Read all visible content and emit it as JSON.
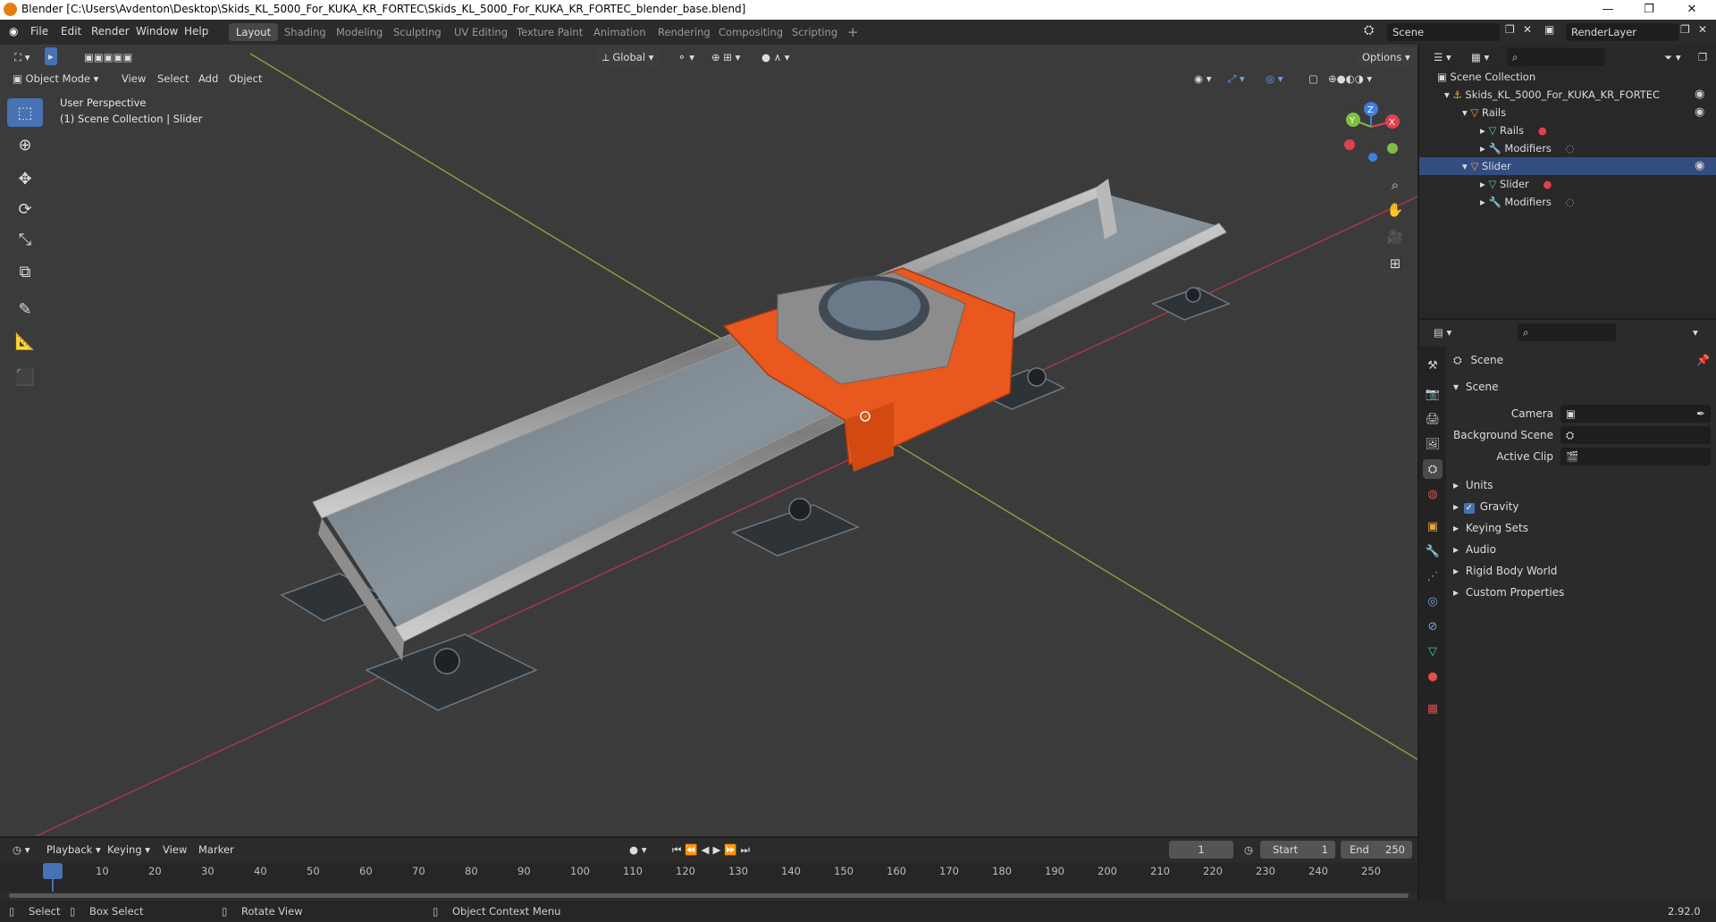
{
  "window": {
    "title": "Blender [C:\\Users\\Avdenton\\Desktop\\Skids_KL_5000_For_KUKA_KR_FORTEC\\Skids_KL_5000_For_KUKA_KR_FORTEC_blender_base.blend]",
    "minimize": "—",
    "maximize": "❐",
    "close": "✕"
  },
  "menu": [
    "File",
    "Edit",
    "Render",
    "Window",
    "Help"
  ],
  "workspaces": [
    "Layout",
    "Shading",
    "Modeling",
    "Sculpting",
    "UV Editing",
    "Texture Paint",
    "Animation",
    "Rendering",
    "Compositing",
    "Scripting"
  ],
  "add_workspace": "+",
  "scene_field": "Scene",
  "renderlayer_field": "RenderLayer",
  "viewport": {
    "mode": "Object Mode",
    "menus": [
      "View",
      "Select",
      "Add",
      "Object"
    ],
    "orientation": "Global",
    "options": "Options",
    "info_line1": "User Perspective",
    "info_line2": "(1) Scene Collection | Slider",
    "gizmo": {
      "x": "X",
      "y": "Y",
      "z": "Z"
    }
  },
  "colors": {
    "accent": "#4772b3",
    "orange": "#e8581f",
    "x_axis": "#e0404f",
    "y_axis": "#7fbf3f",
    "z_axis": "#3f7fe0"
  },
  "outliner": {
    "root": "Scene Collection",
    "items": [
      {
        "label": "Skids_KL_5000_For_KUKA_KR_FORTEC",
        "depth": 1,
        "icon": "armature-icon"
      },
      {
        "label": "Rails",
        "depth": 2,
        "icon": "object-icon"
      },
      {
        "label": "Rails",
        "depth": 3,
        "icon": "mesh-icon"
      },
      {
        "label": "Modifiers",
        "depth": 3,
        "icon": "wrench-icon"
      },
      {
        "label": "Slider",
        "depth": 2,
        "icon": "object-icon"
      },
      {
        "label": "Slider",
        "depth": 3,
        "icon": "mesh-icon"
      },
      {
        "label": "Modifiers",
        "depth": 3,
        "icon": "wrench-icon"
      }
    ]
  },
  "properties": {
    "context": "Scene",
    "panel": "Scene",
    "camera_label": "Camera",
    "background_label": "Background Scene",
    "clip_label": "Active Clip",
    "sections": [
      "Units",
      "Gravity",
      "Keying Sets",
      "Audio",
      "Rigid Body World",
      "Custom Properties"
    ],
    "gravity_checked": true
  },
  "timeline": {
    "menus": [
      "Playback",
      "Keying",
      "View",
      "Marker"
    ],
    "current_frame": "1",
    "start_label": "Start",
    "start": "1",
    "end_label": "End",
    "end": "250",
    "ticks": [
      "1",
      "10",
      "20",
      "30",
      "40",
      "50",
      "60",
      "70",
      "80",
      "90",
      "100",
      "110",
      "120",
      "130",
      "140",
      "150",
      "160",
      "170",
      "180",
      "190",
      "200",
      "210",
      "220",
      "230",
      "240",
      "250"
    ]
  },
  "statusbar": {
    "select": "Select",
    "box_select": "Box Select",
    "rotate": "Rotate View",
    "context_menu": "Object Context Menu",
    "version": "2.92.0"
  }
}
